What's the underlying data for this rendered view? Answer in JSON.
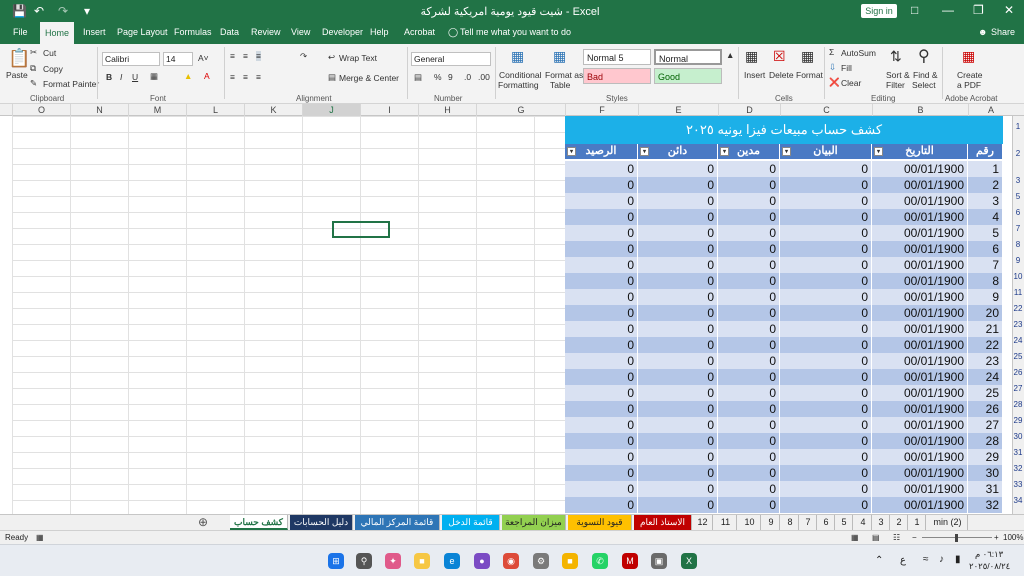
{
  "window": {
    "title": "شيت قيود يومية امريكية لشركة  -  Excel",
    "signin": "Sign in"
  },
  "tabs": [
    "File",
    "Home",
    "Insert",
    "Page Layout",
    "Formulas",
    "Data",
    "Review",
    "Developer",
    "Help",
    "Acrobat"
  ],
  "tellme": "Tell me what you want to do",
  "share": "Share",
  "ribbon": {
    "paste": "Paste",
    "cut": "Cut",
    "copy": "Copy",
    "format_painter": "Format Painter",
    "clipboard": "Clipboard",
    "font_name": "Calibri",
    "font_size": "14",
    "font": "Font",
    "wrap": "Wrap Text",
    "merge": "Merge & Center",
    "alignment": "Alignment",
    "number_format": "General",
    "number": "Number",
    "cond": "Conditional",
    "cond2": "Formatting",
    "formatas": "Format as",
    "formatas2": "Table",
    "style_normal5": "Normal 5",
    "style_normal": "Normal",
    "style_bad": "Bad",
    "style_good": "Good",
    "styles": "Styles",
    "insert": "Insert",
    "delete": "Delete",
    "format": "Format",
    "cells": "Cells",
    "autosum": "AutoSum",
    "fill": "Fill",
    "clear": "Clear",
    "sortfilter": "Sort &",
    "sortfilter2": "Filter",
    "findselect": "Find &",
    "findselect2": "Select",
    "editing": "Editing",
    "createpdf": "Create",
    "createpdf2": "a PDF",
    "adobe": "Adobe Acrobat"
  },
  "columns": [
    "O",
    "N",
    "M",
    "L",
    "K",
    "J",
    "I",
    "H",
    "G",
    "F",
    "E",
    "D",
    "C",
    "B",
    "A"
  ],
  "sheet": {
    "title": "كشف حساب مبيعات فيزا يونيه ٢٠٢٥",
    "headers": [
      "الرصيد",
      "دائن",
      "مدين",
      "البيان",
      "التاريخ",
      "رقم القيد"
    ],
    "rownums": [
      "1",
      "2",
      "3",
      "5",
      "6",
      "7",
      "8",
      "9",
      "10",
      "11",
      "22",
      "23",
      "24",
      "25",
      "26",
      "27",
      "28",
      "29",
      "30",
      "31",
      "32",
      "33",
      "34"
    ],
    "rows": [
      [
        "0",
        "0",
        "0",
        "0",
        "00/01/1900",
        "1"
      ],
      [
        "0",
        "0",
        "0",
        "0",
        "00/01/1900",
        "2"
      ],
      [
        "0",
        "0",
        "0",
        "0",
        "00/01/1900",
        "3"
      ],
      [
        "0",
        "0",
        "0",
        "0",
        "00/01/1900",
        "4"
      ],
      [
        "0",
        "0",
        "0",
        "0",
        "00/01/1900",
        "5"
      ],
      [
        "0",
        "0",
        "0",
        "0",
        "00/01/1900",
        "6"
      ],
      [
        "0",
        "0",
        "0",
        "0",
        "00/01/1900",
        "7"
      ],
      [
        "0",
        "0",
        "0",
        "0",
        "00/01/1900",
        "8"
      ],
      [
        "0",
        "0",
        "0",
        "0",
        "00/01/1900",
        "9"
      ],
      [
        "0",
        "0",
        "0",
        "0",
        "00/01/1900",
        "20"
      ],
      [
        "0",
        "0",
        "0",
        "0",
        "00/01/1900",
        "21"
      ],
      [
        "0",
        "0",
        "0",
        "0",
        "00/01/1900",
        "22"
      ],
      [
        "0",
        "0",
        "0",
        "0",
        "00/01/1900",
        "23"
      ],
      [
        "0",
        "0",
        "0",
        "0",
        "00/01/1900",
        "24"
      ],
      [
        "0",
        "0",
        "0",
        "0",
        "00/01/1900",
        "25"
      ],
      [
        "0",
        "0",
        "0",
        "0",
        "00/01/1900",
        "26"
      ],
      [
        "0",
        "0",
        "0",
        "0",
        "00/01/1900",
        "27"
      ],
      [
        "0",
        "0",
        "0",
        "0",
        "00/01/1900",
        "28"
      ],
      [
        "0",
        "0",
        "0",
        "0",
        "00/01/1900",
        "29"
      ],
      [
        "0",
        "0",
        "0",
        "0",
        "00/01/1900",
        "30"
      ],
      [
        "0",
        "0",
        "0",
        "0",
        "00/01/1900",
        "31"
      ],
      [
        "0",
        "0",
        "0",
        "0",
        "00/01/1900",
        "32"
      ]
    ]
  },
  "sheettabs": [
    {
      "label": "كشف حساب",
      "color": "#ffffff"
    },
    {
      "label": "دليل الحسابات",
      "color": "#1f3864"
    },
    {
      "label": "قائمة المركز المالي",
      "color": "#2e75b6"
    },
    {
      "label": "قائمة الدخل",
      "color": "#00b0f0"
    },
    {
      "label": "ميزان المراجعة",
      "color": "#92d050"
    },
    {
      "label": "قيود التسوية",
      "color": "#ffc000"
    },
    {
      "label": "الاستاذ العام",
      "color": "#c00000"
    },
    {
      "label": "12",
      "color": ""
    },
    {
      "label": "11",
      "color": ""
    },
    {
      "label": "10",
      "color": ""
    },
    {
      "label": "9",
      "color": ""
    },
    {
      "label": "8",
      "color": ""
    },
    {
      "label": "7",
      "color": ""
    },
    {
      "label": "6",
      "color": ""
    },
    {
      "label": "5",
      "color": ""
    },
    {
      "label": "4",
      "color": ""
    },
    {
      "label": "3",
      "color": ""
    },
    {
      "label": "2",
      "color": ""
    },
    {
      "label": "1",
      "color": ""
    },
    {
      "label": "min (2)",
      "color": ""
    }
  ],
  "status": {
    "ready": "Ready",
    "zoom": "100%"
  },
  "clock": {
    "time": "٠٦:١٣ م",
    "date": "٢٠٢٥/٠٨/٢٤"
  }
}
